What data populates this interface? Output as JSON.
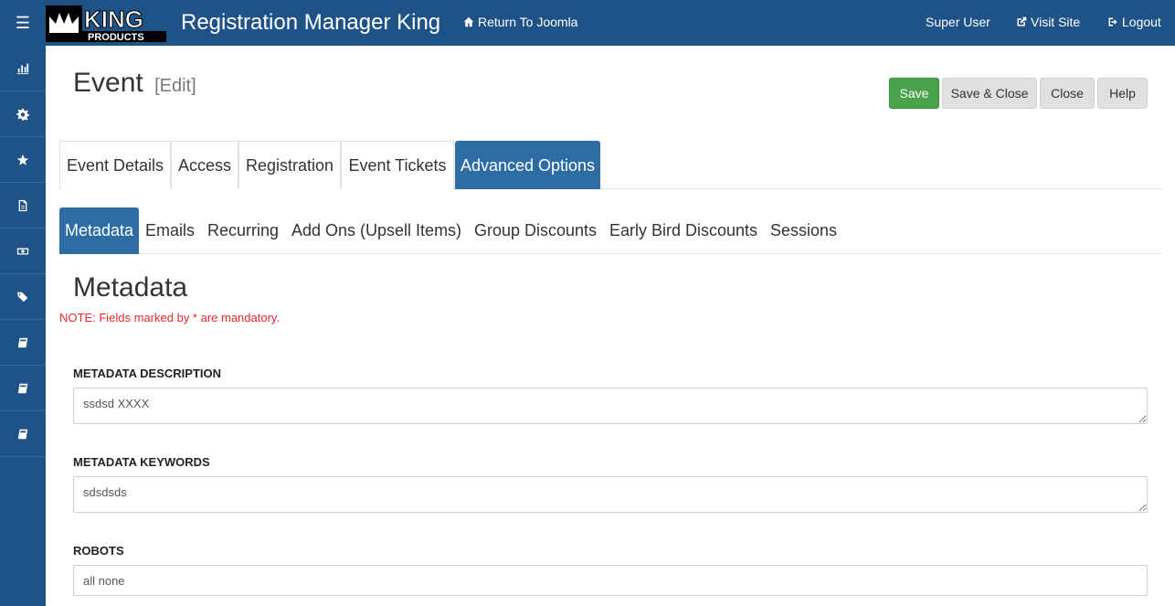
{
  "header": {
    "menu_icon": "hamburger-icon",
    "logo_text_top": "KING",
    "logo_text_bottom": "PRODUCTS",
    "app_title": "Registration Manager King",
    "return_link": "Return To Joomla",
    "user": "Super User",
    "visit_site": "Visit Site",
    "logout": "Logout",
    "brand_color": "#1f5387"
  },
  "sidebar": {
    "items": [
      {
        "icon": "bar-chart-icon"
      },
      {
        "icon": "gear-icon"
      },
      {
        "icon": "star-icon"
      },
      {
        "icon": "document-icon"
      },
      {
        "icon": "money-icon"
      },
      {
        "icon": "tags-icon"
      },
      {
        "icon": "book-icon"
      },
      {
        "icon": "book-icon"
      },
      {
        "icon": "book-icon"
      }
    ]
  },
  "page": {
    "title": "Event",
    "edit_label": "[Edit]"
  },
  "toolbar": {
    "save": "Save",
    "save_close": "Save & Close",
    "close": "Close",
    "help": "Help"
  },
  "tabs": [
    {
      "label": "Event Details"
    },
    {
      "label": "Access"
    },
    {
      "label": "Registration"
    },
    {
      "label": "Event Tickets"
    },
    {
      "label": "Advanced Options",
      "active": true
    }
  ],
  "subtabs": [
    {
      "label": "Metadata",
      "active": true
    },
    {
      "label": "Emails"
    },
    {
      "label": "Recurring"
    },
    {
      "label": "Add Ons (Upsell Items)"
    },
    {
      "label": "Group Discounts"
    },
    {
      "label": "Early Bird Discounts"
    },
    {
      "label": "Sessions"
    }
  ],
  "section": {
    "title": "Metadata",
    "note": "NOTE: Fields marked by * are mandatory."
  },
  "fields": {
    "description": {
      "label": "METADATA DESCRIPTION",
      "value": "ssdsd XXXX"
    },
    "keywords": {
      "label": "METADATA KEYWORDS",
      "value": "sdsdsds"
    },
    "robots": {
      "label": "ROBOTS",
      "value": "all none"
    }
  }
}
